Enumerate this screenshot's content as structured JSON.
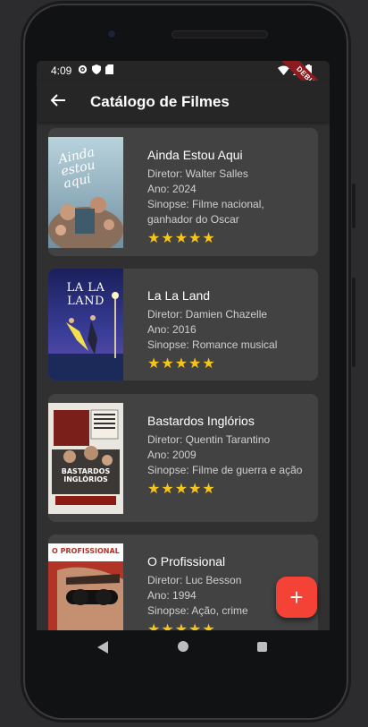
{
  "status": {
    "time": "4:09",
    "debug_label": "DEBUG"
  },
  "appbar": {
    "title": "Catálogo de Filmes"
  },
  "movies": [
    {
      "title": "Ainda Estou Aqui",
      "director": "Diretor: Walter Salles",
      "year": "Ano: 2024",
      "synopsis": "Sinopse: Filme nacional, ganhador do Oscar",
      "stars": "★★★★★",
      "poster_text": "Ainda estou aqui"
    },
    {
      "title": "La La Land",
      "director": "Diretor: Damien Chazelle",
      "year": "Ano: 2016",
      "synopsis": "Sinopse: Romance musical",
      "stars": "★★★★★",
      "poster_text": "LA LA LAND"
    },
    {
      "title": "Bastardos Inglórios",
      "director": "Diretor: Quentin Tarantino",
      "year": "Ano: 2009",
      "synopsis": "Sinopse: Filme de guerra e ação",
      "stars": "★★★★★",
      "poster_text": "BASTARDOS INGLÓRIOS"
    },
    {
      "title": "O Profissional",
      "director": "Diretor: Luc Besson",
      "year": "Ano: 1994",
      "synopsis": "Sinopse: Ação, crime",
      "stars": "★★★★★",
      "poster_text": "O PROFISSIONAL"
    }
  ],
  "fab": {
    "label": "+"
  },
  "colors": {
    "accent": "#f44336",
    "star": "#f5c518",
    "card": "#424242",
    "background": "#303030"
  }
}
